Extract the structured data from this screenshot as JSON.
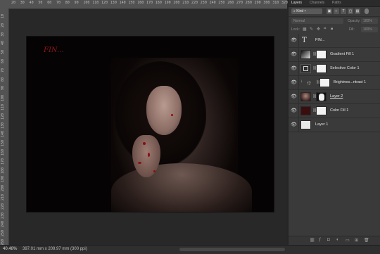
{
  "rulers": {
    "top": [
      "20",
      "30",
      "40",
      "50",
      "60",
      "70",
      "80",
      "90",
      "100",
      "110",
      "120",
      "130",
      "140",
      "150",
      "160",
      "170",
      "180",
      "190",
      "200",
      "210",
      "220",
      "230",
      "240",
      "250",
      "260",
      "270",
      "280",
      "290",
      "300",
      "310",
      "320"
    ],
    "left": [
      "10",
      "20",
      "30",
      "40",
      "50",
      "60",
      "70",
      "80",
      "90",
      "100",
      "110",
      "120",
      "130",
      "140",
      "150",
      "160",
      "170",
      "180",
      "190",
      "200",
      "210",
      "220",
      "230",
      "240",
      "250",
      "260"
    ]
  },
  "document": {
    "text_layer_content": "FIN..."
  },
  "status": {
    "zoom": "40.48%",
    "doc_info": "397.01 mm x 209.97 mm (300 ppi)"
  },
  "panel": {
    "tabs": [
      "Layers",
      "Channels",
      "Paths"
    ],
    "filter": {
      "kind_label": "Kind",
      "icons": [
        "image-filter-icon",
        "adjustment-filter-icon",
        "type-filter-icon",
        "shape-filter-icon",
        "smart-object-filter-icon"
      ]
    },
    "blend_mode": "Normal",
    "opacity_label": "Opacity:",
    "opacity_value": "100%",
    "lock_label": "Lock:",
    "fill_label": "Fill:",
    "fill_value": "100%",
    "layers": [
      {
        "name": "FIN...",
        "type": "text",
        "visible": true
      },
      {
        "name": "Gradient Fill 1",
        "type": "gradient-fill",
        "visible": true
      },
      {
        "name": "Selective Color 1",
        "type": "adjustment",
        "visible": true
      },
      {
        "name": "Brightnes...ntrast 1",
        "type": "adjustment",
        "visible": true
      },
      {
        "name": "Layer 2",
        "type": "image-masked",
        "visible": true
      },
      {
        "name": "Color Fill 1",
        "type": "color-fill",
        "visible": true
      },
      {
        "name": "Layer 1",
        "type": "image",
        "visible": true
      }
    ]
  },
  "colors": {
    "text_accent": "#8e1618",
    "panel_bg": "#3a3a3a",
    "canvas_bg": "#282828",
    "color_fill_swatch": "#3a0e0e"
  }
}
